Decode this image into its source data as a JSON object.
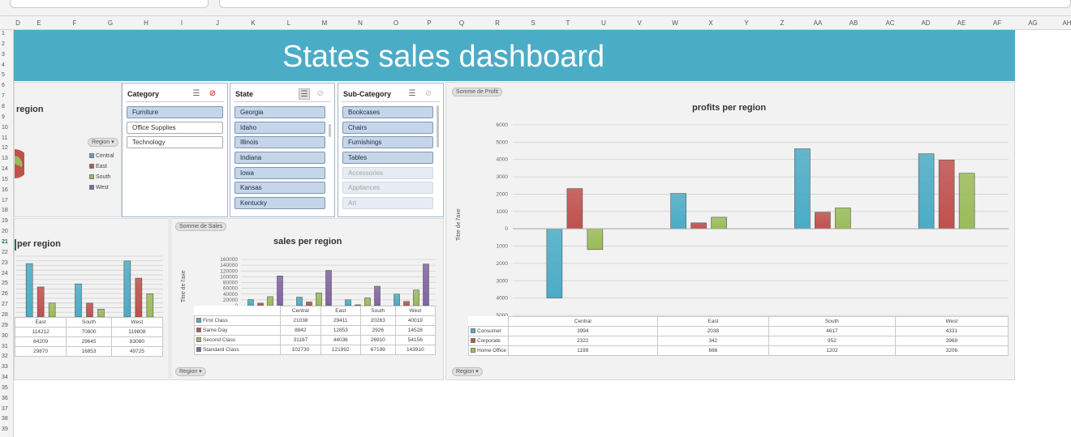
{
  "colors": {
    "banner": "#4bacc6",
    "series1": "#4bacc6",
    "series2": "#c0504d",
    "series3": "#9bbb59",
    "series4": "#8064a2"
  },
  "sheet": {
    "columns": [
      "D",
      "E",
      "F",
      "G",
      "H",
      "I",
      "J",
      "K",
      "L",
      "M",
      "N",
      "O",
      "P",
      "Q",
      "R",
      "S",
      "T",
      "U",
      "V",
      "W",
      "X",
      "Y",
      "Z",
      "AA",
      "AB",
      "AC",
      "AD",
      "AE",
      "AF",
      "AG",
      "AH"
    ],
    "rows": [
      "1",
      "2",
      "3",
      "4",
      "5",
      "6",
      "7",
      "8",
      "9",
      "10",
      "11",
      "12",
      "13",
      "14",
      "15",
      "16",
      "17",
      "18",
      "19",
      "20",
      "21",
      "22",
      "23",
      "24",
      "25",
      "26",
      "27",
      "28",
      "29",
      "30",
      "31",
      "32",
      "33",
      "34",
      "35",
      "36",
      "37",
      "38",
      "39"
    ]
  },
  "dashboard": {
    "title": "States sales dashboard"
  },
  "pie_chart": {
    "title": "region",
    "legend_button": "Region",
    "legend": [
      "Central",
      "East",
      "South",
      "West"
    ]
  },
  "slicers": {
    "category": {
      "header": "Category",
      "items": [
        "Furniture",
        "Office Supplies",
        "Technology"
      ]
    },
    "state": {
      "header": "State",
      "items": [
        "Georgia",
        "Idaho",
        "Illinois",
        "Indiana",
        "Iowa",
        "Kansas",
        "Kentucky"
      ]
    },
    "subcategory": {
      "header": "Sub-Category",
      "items": [
        "Bookcases",
        "Chairs",
        "Furnishings",
        "Tables",
        "Accessories",
        "Appliances",
        "Art"
      ]
    }
  },
  "left_chart": {
    "title": "per region",
    "categories": [
      "East",
      "South",
      "West"
    ],
    "table": [
      [
        "114212",
        "70800",
        "119808"
      ],
      [
        "64209",
        "29645",
        "83080"
      ],
      [
        "29870",
        "16853",
        "49725"
      ]
    ]
  },
  "sales_chart": {
    "field_button": "Somme de Sales",
    "axis_button": "Region",
    "title": "sales per region",
    "y_title": "Titre de l'axe",
    "y_ticks": [
      "160000",
      "140000",
      "120000",
      "100000",
      "80000",
      "60000",
      "40000",
      "20000",
      "0"
    ]
  },
  "profit_chart": {
    "field_button": "Somme de Profit",
    "axis_button": "Region",
    "title": "profits per region",
    "y_title": "Titre de l'axe",
    "y_ticks": [
      "6000",
      "5000",
      "4000",
      "3000",
      "2000",
      "1000",
      "0",
      "1000",
      "2000",
      "3000",
      "4000",
      "5000"
    ]
  },
  "chart_data": [
    {
      "type": "bar",
      "title": "per region",
      "categories": [
        "East",
        "South",
        "West"
      ],
      "series": [
        {
          "values": [
            114212,
            70800,
            119808
          ]
        },
        {
          "values": [
            64209,
            29645,
            83080
          ]
        },
        {
          "values": [
            29870,
            16853,
            49725
          ]
        }
      ]
    },
    {
      "type": "bar",
      "title": "sales per region",
      "ylabel": "Titre de l'axe",
      "categories": [
        "Central",
        "East",
        "South",
        "West"
      ],
      "ylim": [
        0,
        160000
      ],
      "series": [
        {
          "name": "First Class",
          "values": [
            21038,
            29411,
            20263,
            40019
          ]
        },
        {
          "name": "Same Day",
          "values": [
            8842,
            12853,
            2926,
            14528
          ]
        },
        {
          "name": "Second Class",
          "values": [
            31187,
            44036,
            26910,
            54156
          ]
        },
        {
          "name": "Standard Class",
          "values": [
            102730,
            121992,
            67199,
            143910
          ]
        }
      ]
    },
    {
      "type": "bar",
      "title": "profits per region",
      "ylabel": "Titre de l'axe",
      "categories": [
        "Central",
        "East",
        "South",
        "West"
      ],
      "ylim": [
        -5000,
        6000
      ],
      "series": [
        {
          "name": "Consumer",
          "values": [
            -3994,
            2038,
            4617,
            4331
          ]
        },
        {
          "name": "Corporate",
          "values": [
            2322,
            342,
            952,
            3969
          ]
        },
        {
          "name": "Home Office",
          "values": [
            -1199,
            666,
            1202,
            3206
          ]
        }
      ]
    }
  ]
}
